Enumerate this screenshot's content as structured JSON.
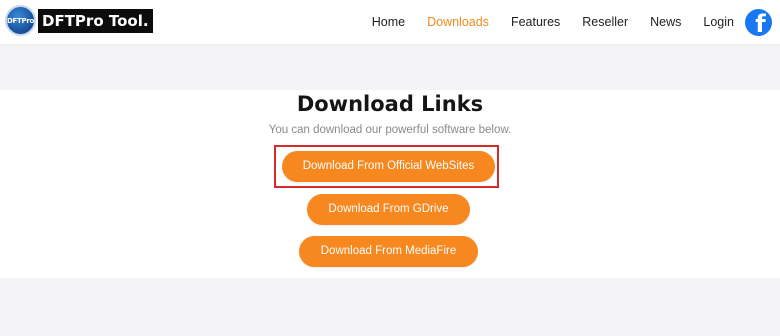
{
  "header": {
    "logo_badge_text": "DFTPro",
    "logo_text": "DFTPro Tool.",
    "nav": [
      "Home",
      "Downloads",
      "Features",
      "Reseller",
      "News",
      "Login"
    ],
    "active_nav": "Downloads",
    "social_icon": "facebook-icon"
  },
  "main": {
    "title": "Download Links",
    "subtitle": "You can download our powerful software below.",
    "buttons": [
      "Download From Official WebSites",
      "Download From GDrive",
      "Download From MediaFire"
    ],
    "highlighted_button": "Download From Official WebSites"
  },
  "colors": {
    "accent": "#f7871f",
    "highlight_border": "#d62a2a",
    "facebook": "#1877f2"
  }
}
